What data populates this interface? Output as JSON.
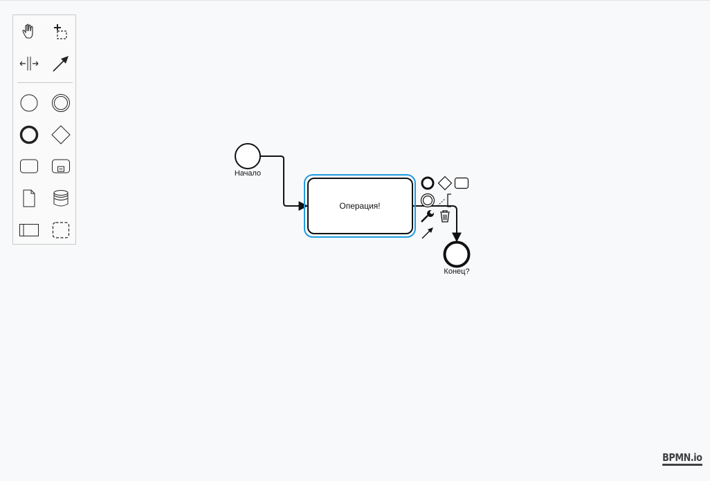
{
  "palette": {
    "tools": [
      {
        "name": "hand-tool",
        "icon": "hand-icon"
      },
      {
        "name": "lasso-tool",
        "icon": "lasso-icon"
      },
      {
        "name": "space-tool",
        "icon": "space-icon"
      },
      {
        "name": "global-connect-tool",
        "icon": "connect-arrow-icon"
      }
    ],
    "shapes": [
      {
        "name": "start-event",
        "icon": "start-event-icon"
      },
      {
        "name": "intermediate-event",
        "icon": "intermediate-event-icon"
      },
      {
        "name": "end-event",
        "icon": "end-event-icon"
      },
      {
        "name": "gateway",
        "icon": "gateway-icon"
      },
      {
        "name": "task",
        "icon": "task-icon"
      },
      {
        "name": "subprocess",
        "icon": "subprocess-icon"
      },
      {
        "name": "data-object",
        "icon": "data-object-icon"
      },
      {
        "name": "data-store",
        "icon": "data-store-icon"
      },
      {
        "name": "pool",
        "icon": "pool-icon"
      },
      {
        "name": "group",
        "icon": "group-icon"
      }
    ]
  },
  "diagram": {
    "start_label": "Начало",
    "task_label": "Операция!",
    "end_label": "Конец?"
  },
  "context_pad": [
    "end-event-icon",
    "gateway-icon",
    "task-icon",
    "intermediate-event-icon",
    "text-annotation-icon",
    "wrench-icon",
    "trash-icon",
    "connect-arrow-icon"
  ],
  "colors": {
    "selection": "#1d9be0",
    "stroke": "#111111",
    "background": "#f8f9fb"
  },
  "watermark": "BPMN.io"
}
